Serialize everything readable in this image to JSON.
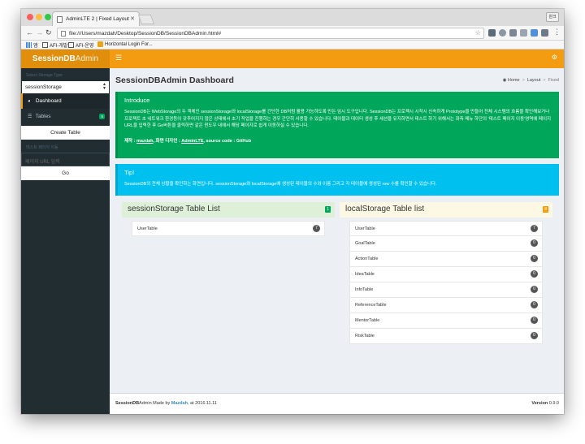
{
  "browser": {
    "tab_title": "AdminLTE 2 | Fixed Layout",
    "url": "file:///Users/mazdah/Desktop/SessionDB/SessionDBAdmin.html#",
    "profile": "원크",
    "bookmarks": [
      {
        "label": "앱",
        "color": "#4285f4"
      },
      {
        "label": "AFI-개발",
        "color": "#555555"
      },
      {
        "label": "AFI-운영",
        "color": "#555555"
      },
      {
        "label": "Horizontal Login For...",
        "color": "#e8a317"
      }
    ]
  },
  "brand": {
    "bold": "SessionDB",
    "light": "Admin"
  },
  "sidebar": {
    "storage_label": "Select Storage Type",
    "storage_value": "sessionStorage",
    "menu": [
      {
        "label": "Dashboard",
        "icon": "dashboard-icon"
      },
      {
        "label": "Tables",
        "icon": "table-icon",
        "badge": "5"
      }
    ],
    "create_button": "Create Table",
    "url_label": "테스트 페이지 이동",
    "url_placeholder": "페이지 URL 입력",
    "go_button": "Go"
  },
  "header": {
    "title": "SessionDBAdmin Dashboard"
  },
  "breadcrumb": {
    "home": "Home",
    "layout": "Layout",
    "current": "Fixed"
  },
  "introduce": {
    "title": "Introduce",
    "text": "SessionDB는 WebStorage의 두 객체인 sessionStorage와 localStorage를 간단한 DB처럼 활용 가능하도록 만든 임시 도구입니다. SessionDB는 프로젝시 시작시 신속하게 Prototype을 만들어 전체 시스템의 흐름을 확인해보거나 프로젝트 초 네트워크 환경등이 갖추어지지 않은 상태에서 초기 작업을 진행하는 경우 간단히 사용할 수 있습니다. 테이블과 데이터 생성 후 세션을 유지하면서 테스트 하기 위해서는 좌측 메뉴 하단의 '테스트 페이지 이동'영역에 페이지 URL을 입력한 후 Go버튼을 클릭하면 같은 윈도우 내에서 해당 페이지로 쉽게 이동하실 수 있습니다.",
    "sig_prefix": "제작 : ",
    "author": "mazdah",
    "design_prefix": ", 화면 디자인 : ",
    "design": "AdminLTE",
    "source": ", source code : GitHub"
  },
  "tip": {
    "title": "Tip!",
    "text": "SessionDB의 전체 상황을 확인하는 화면입니다. sessionStorage와 localStorage에 생성된 테이블의 수와 이름 그리고 각 테이블에 생성된 row 수를 확인할 수 있습니다."
  },
  "session_box": {
    "title": "sessionStorage Table List",
    "count": "1",
    "tables": [
      {
        "name": "UserTable",
        "rows": "7"
      }
    ]
  },
  "local_box": {
    "title": "localStorage Table list",
    "count": "8",
    "tables": [
      {
        "name": "UserTable",
        "rows": "7"
      },
      {
        "name": "GoalTable",
        "rows": "0"
      },
      {
        "name": "ActionTable",
        "rows": "0"
      },
      {
        "name": "IdeaTable",
        "rows": "0"
      },
      {
        "name": "InfoTable",
        "rows": "0"
      },
      {
        "name": "ReferenceTable",
        "rows": "0"
      },
      {
        "name": "MentorTable",
        "rows": "0"
      },
      {
        "name": "RiskTable",
        "rows": "0"
      }
    ]
  },
  "footer": {
    "app_bold": "SessionDB",
    "app_light": "Admin",
    "made_by": " Made by ",
    "author": "Mazdah",
    "date": ", at 2016.11.11",
    "version_label": "Version",
    "version": " 0.9.0"
  },
  "colors": {
    "brand_orange": "#f39c12",
    "logo_orange": "#e08e0b",
    "sidebar_dark": "#222d32",
    "success_green": "#00a65a",
    "info_blue": "#00c0ef"
  }
}
